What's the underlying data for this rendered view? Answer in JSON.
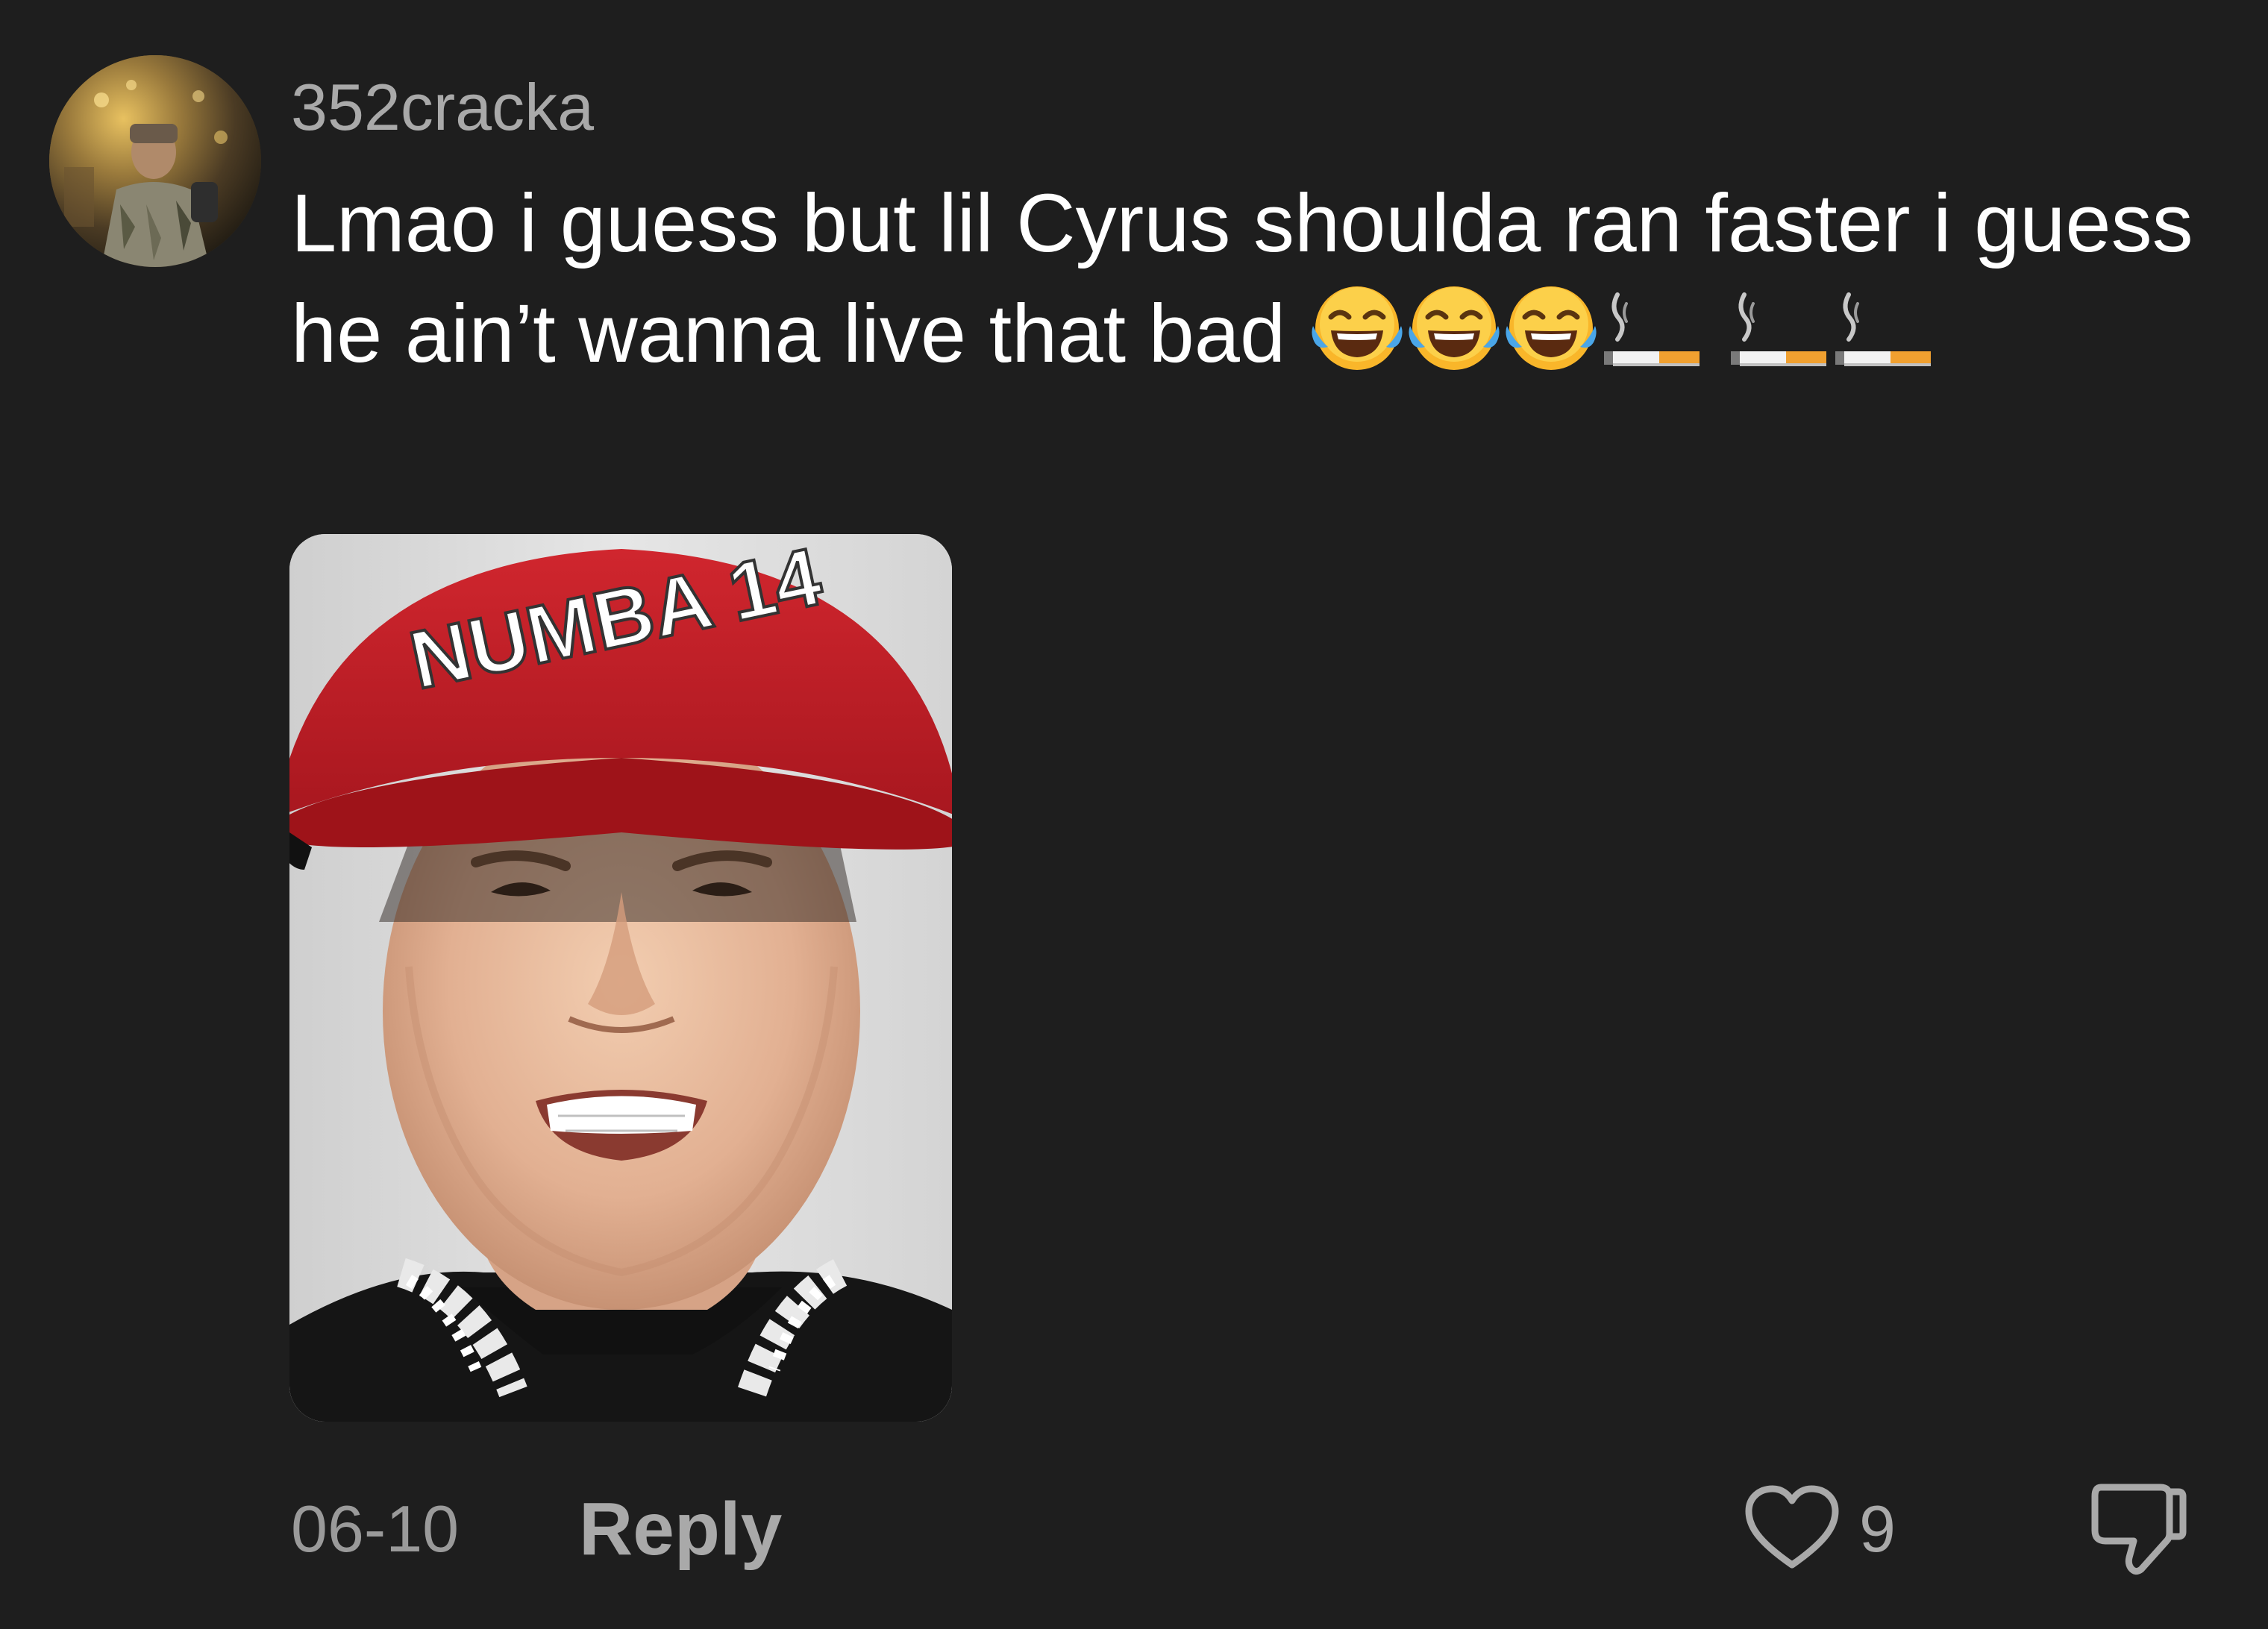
{
  "comment": {
    "username": "352cracka",
    "text": "Lmao i guess but lil Cyrus shoulda ran faster i guess he ain’t wanna live that bad",
    "emojis": [
      "tears-of-joy",
      "tears-of-joy",
      "tears-of-joy",
      "cigarette",
      "cigarette",
      "cigarette"
    ],
    "media": {
      "cap_text": "NUMBA 14"
    },
    "date": "06-10",
    "reply_label": "Reply",
    "like_count": "9",
    "icons": {
      "like": "heart-outline-icon",
      "dislike": "thumbs-down-icon"
    }
  },
  "colors": {
    "background": "#1e1e1e",
    "username": "#a9a9a9",
    "text": "#ffffff",
    "muted": "#9a9a9a",
    "cap_red": "#c8222a"
  }
}
